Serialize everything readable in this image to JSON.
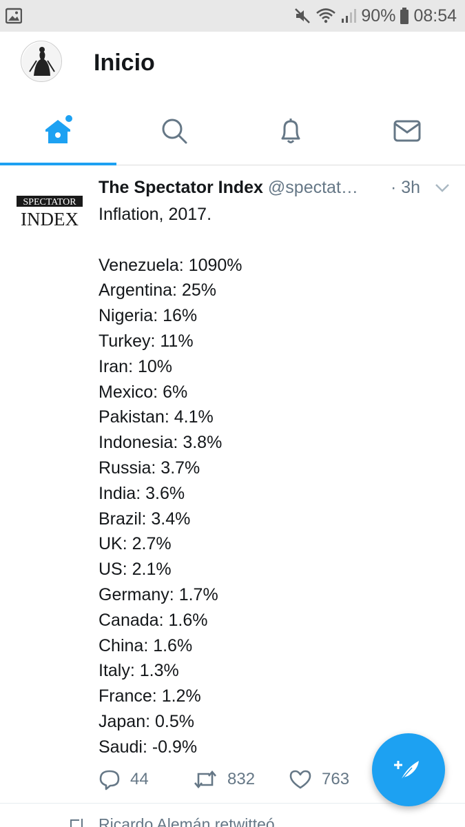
{
  "status_bar": {
    "battery": "90%",
    "time": "08:54",
    "icons": [
      "gallery-icon",
      "mute-icon",
      "wifi-icon",
      "signal-icon",
      "battery-icon"
    ]
  },
  "header": {
    "title": "Inicio"
  },
  "tabs": [
    {
      "name": "home",
      "icon": "home-icon",
      "active": true
    },
    {
      "name": "search",
      "icon": "search-icon",
      "active": false
    },
    {
      "name": "notifications",
      "icon": "bell-icon",
      "active": false
    },
    {
      "name": "messages",
      "icon": "mail-icon",
      "active": false
    }
  ],
  "tweet": {
    "avatar_text_top": "SPECTATOR",
    "avatar_text_bottom": "INDEX",
    "author_name": "The Spectator Index",
    "handle": "@spectat…",
    "time": "· 3h",
    "lines": [
      "Inflation, 2017.",
      "",
      "Venezuela: 1090%",
      "Argentina: 25%",
      "Nigeria: 16%",
      "Turkey: 11%",
      "Iran: 10%",
      "Mexico: 6%",
      "Pakistan: 4.1%",
      "Indonesia: 3.8%",
      "Russia: 3.7%",
      "India: 3.6%",
      "Brazil: 3.4%",
      "UK: 2.7%",
      "US: 2.1%",
      "Germany: 1.7%",
      "Canada: 1.6%",
      "China: 1.6%",
      "Italy: 1.3%",
      "France: 1.2%",
      "Japan: 0.5%",
      "Saudi: -0.9%"
    ],
    "replies": "44",
    "retweets": "832",
    "likes": "763"
  },
  "next_item": {
    "retweet_text": "Ricardo Alemán retwitteó"
  },
  "colors": {
    "accent": "#1da1f2",
    "icon_gray": "#657786",
    "text": "#14171a"
  }
}
